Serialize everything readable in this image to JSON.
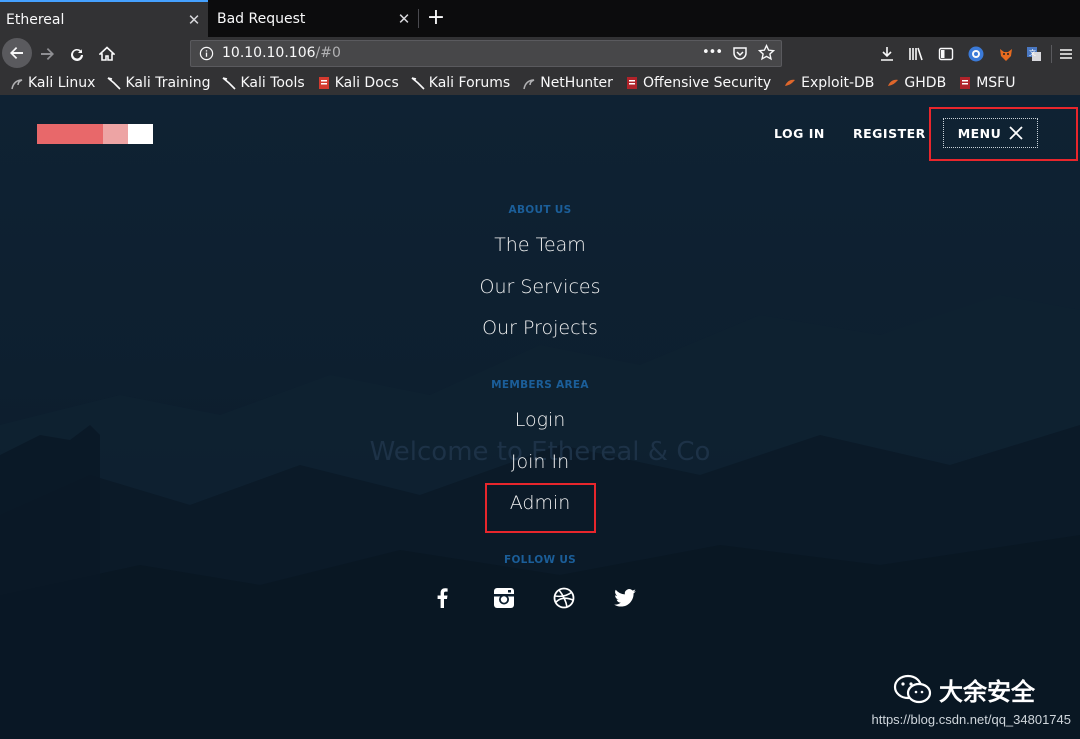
{
  "tabs": [
    {
      "label": "Ethereal",
      "close": "✕"
    },
    {
      "label": "Bad Request",
      "close": "✕"
    }
  ],
  "new_tab_label": "+",
  "urlbar": {
    "host": "10.10.10.106",
    "path": "/#0",
    "more": "•••"
  },
  "bookmarks": [
    {
      "label": "Kali Linux",
      "icon": "kali-icon"
    },
    {
      "label": "Kali Training",
      "icon": "kali-dragon-icon"
    },
    {
      "label": "Kali Tools",
      "icon": "kali-dragon-icon"
    },
    {
      "label": "Kali Docs",
      "icon": "docs-icon"
    },
    {
      "label": "Kali Forums",
      "icon": "kali-dragon-icon"
    },
    {
      "label": "NetHunter",
      "icon": "kali-icon"
    },
    {
      "label": "Offensive Security",
      "icon": "offsec-icon"
    },
    {
      "label": "Exploit-DB",
      "icon": "exploitdb-icon"
    },
    {
      "label": "GHDB",
      "icon": "exploitdb-icon"
    },
    {
      "label": "MSFU",
      "icon": "offsec-icon"
    }
  ],
  "site": {
    "logo_colors": [
      "#e8686a",
      "#eda4a4",
      "#ffffff"
    ],
    "nav": {
      "login": "LOG IN",
      "register": "REGISTER",
      "menu": "MENU"
    },
    "menu_sections": [
      {
        "title": "ABOUT US",
        "links": [
          "The Team",
          "Our Services",
          "Our Projects"
        ]
      },
      {
        "title": "MEMBERS AREA",
        "links": [
          "Login",
          "Join In",
          "Admin"
        ]
      },
      {
        "title": "FOLLOW US",
        "links": []
      }
    ],
    "welcome": "Welcome to Ethereal & Co",
    "social": [
      "facebook-icon",
      "instagram-icon",
      "dribbble-icon",
      "twitter-icon"
    ]
  },
  "watermark": {
    "brand": "大余安全",
    "url": "https://blog.csdn.net/qq_34801745"
  },
  "colors": {
    "highlight": "#e8262c",
    "section_title": "#1b5e99",
    "tab_accent": "#45a1ff"
  }
}
